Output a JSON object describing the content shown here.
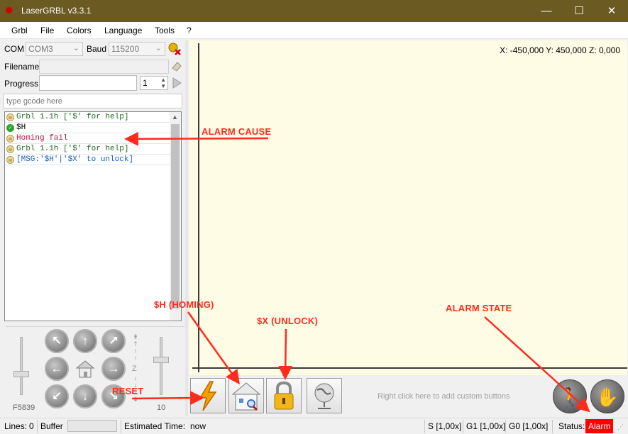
{
  "window": {
    "title": "LaserGRBL v3.3.1",
    "minimize": "—",
    "maximize": "☐",
    "close": "✕"
  },
  "menu": [
    "Grbl",
    "File",
    "Colors",
    "Language",
    "Tools",
    "?"
  ],
  "connection": {
    "com_label": "COM",
    "com_value": "COM3",
    "baud_label": "Baud",
    "baud_value": "115200"
  },
  "file": {
    "filename_label": "Filename",
    "progress_label": "Progress",
    "copies": "1"
  },
  "gcode_input": {
    "placeholder": "type gcode here"
  },
  "console": {
    "lines": [
      {
        "text": "Grbl 1.1h ['$' for help]",
        "kind": "info",
        "color": "#1e6b1e"
      },
      {
        "text": "$H",
        "kind": "ok",
        "color": "#000000"
      },
      {
        "text": "Homing fail",
        "kind": "info",
        "color": "#c0143c"
      },
      {
        "text": "Grbl 1.1h ['$' for help]",
        "kind": "info",
        "color": "#1e6b1e"
      },
      {
        "text": "[MSG:'$H'|'$X' to unlock]",
        "kind": "info",
        "color": "#1f5fc7"
      }
    ]
  },
  "jog": {
    "feed_label": "F5839",
    "step_label": "10",
    "z_label": "Z"
  },
  "canvas": {
    "coords": "X: -450,000 Y: 450,000 Z: 0,000"
  },
  "buttons_bar": {
    "custom_hint": "Right click here to add custom buttons"
  },
  "statusbar": {
    "lines_label": "Lines:",
    "lines_value": "0",
    "buffer_label": "Buffer",
    "est_label": "Estimated Time:",
    "est_value": "now",
    "s_override": "S [1,00x]",
    "g1_override": "G1 [1,00x]",
    "g0_override": "G0 [1,00x]",
    "status_label": "Status:",
    "status_value": "Alarm"
  },
  "annotations": {
    "alarm_cause": "ALARM CAUSE",
    "homing": "$H (HOMING)",
    "unlock": "$X (UNLOCK)",
    "alarm_state": "ALARM STATE",
    "reset": "RESET"
  },
  "colors": {
    "titlebar": "#6b5a22",
    "canvas": "#fffce6",
    "alarm": "#ff0000",
    "annotation": "#ff2b1c"
  }
}
